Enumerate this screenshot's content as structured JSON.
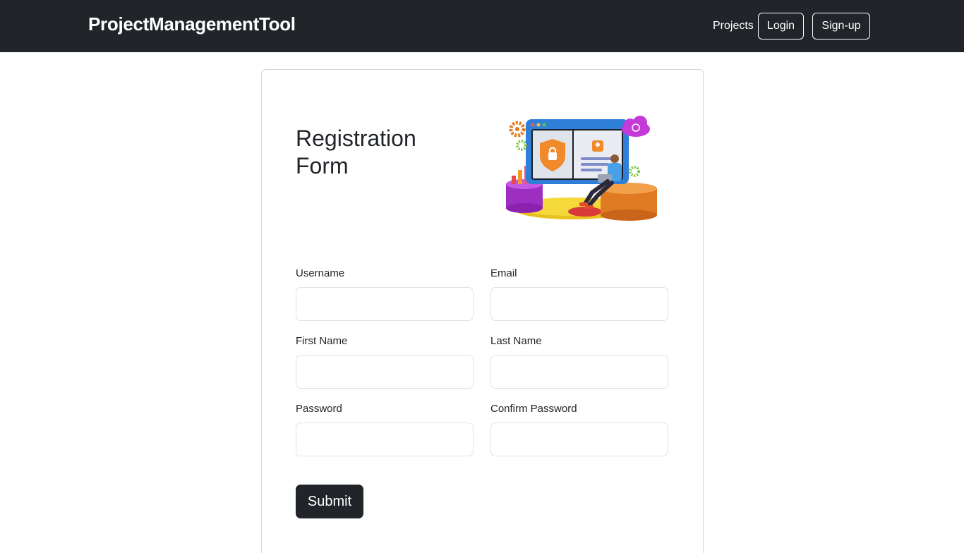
{
  "navbar": {
    "brand": "ProjectManagementTool",
    "links": [
      "Projects"
    ],
    "login_label": "Login",
    "signup_label": "Sign-up"
  },
  "form": {
    "title": "Registration Form",
    "illustration_icon": "registration-security-illustration",
    "fields": [
      {
        "label": "Username",
        "value": "",
        "placeholder": ""
      },
      {
        "label": "Email",
        "value": "",
        "placeholder": ""
      },
      {
        "label": "First Name",
        "value": "",
        "placeholder": ""
      },
      {
        "label": "Last Name",
        "value": "",
        "placeholder": ""
      },
      {
        "label": "Password",
        "value": "",
        "placeholder": ""
      },
      {
        "label": "Confirm Password",
        "value": "",
        "placeholder": ""
      }
    ],
    "submit_label": "Submit"
  },
  "colors": {
    "navbar_bg": "#212529",
    "button_dark": "#212529",
    "border": "#dee2e6"
  }
}
